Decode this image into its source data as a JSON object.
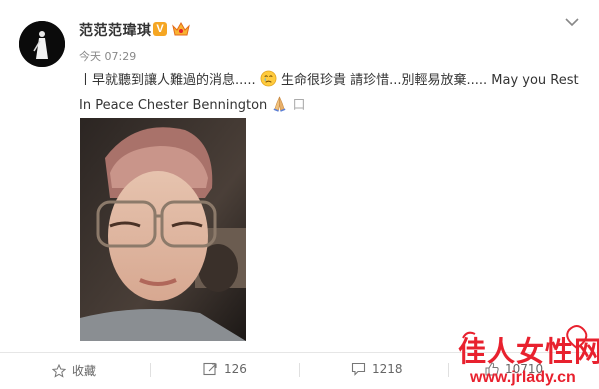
{
  "post": {
    "username": "范范范瑋琪",
    "verified_badge": "V",
    "timestamp": "今天 07:29",
    "text_part1": "丨早就聽到讓人難過的消息.....",
    "text_part2": " 生命很珍貴 請珍惜...別輕易放棄.....  May you Rest In Peace Chester Bennington ",
    "text_part3": "口",
    "emoji_1": "crying-face",
    "emoji_2": "praying-hands"
  },
  "actions": {
    "favorite_label": "收藏",
    "repost_count": "126",
    "comment_count": "1218",
    "like_count": "10710"
  },
  "watermark": {
    "title": "佳人女性网",
    "url": "www.jrlady.cn"
  },
  "colors": {
    "accent": "#e8212e",
    "badge": "#f5a623",
    "text": "#333333",
    "muted": "#888888"
  }
}
